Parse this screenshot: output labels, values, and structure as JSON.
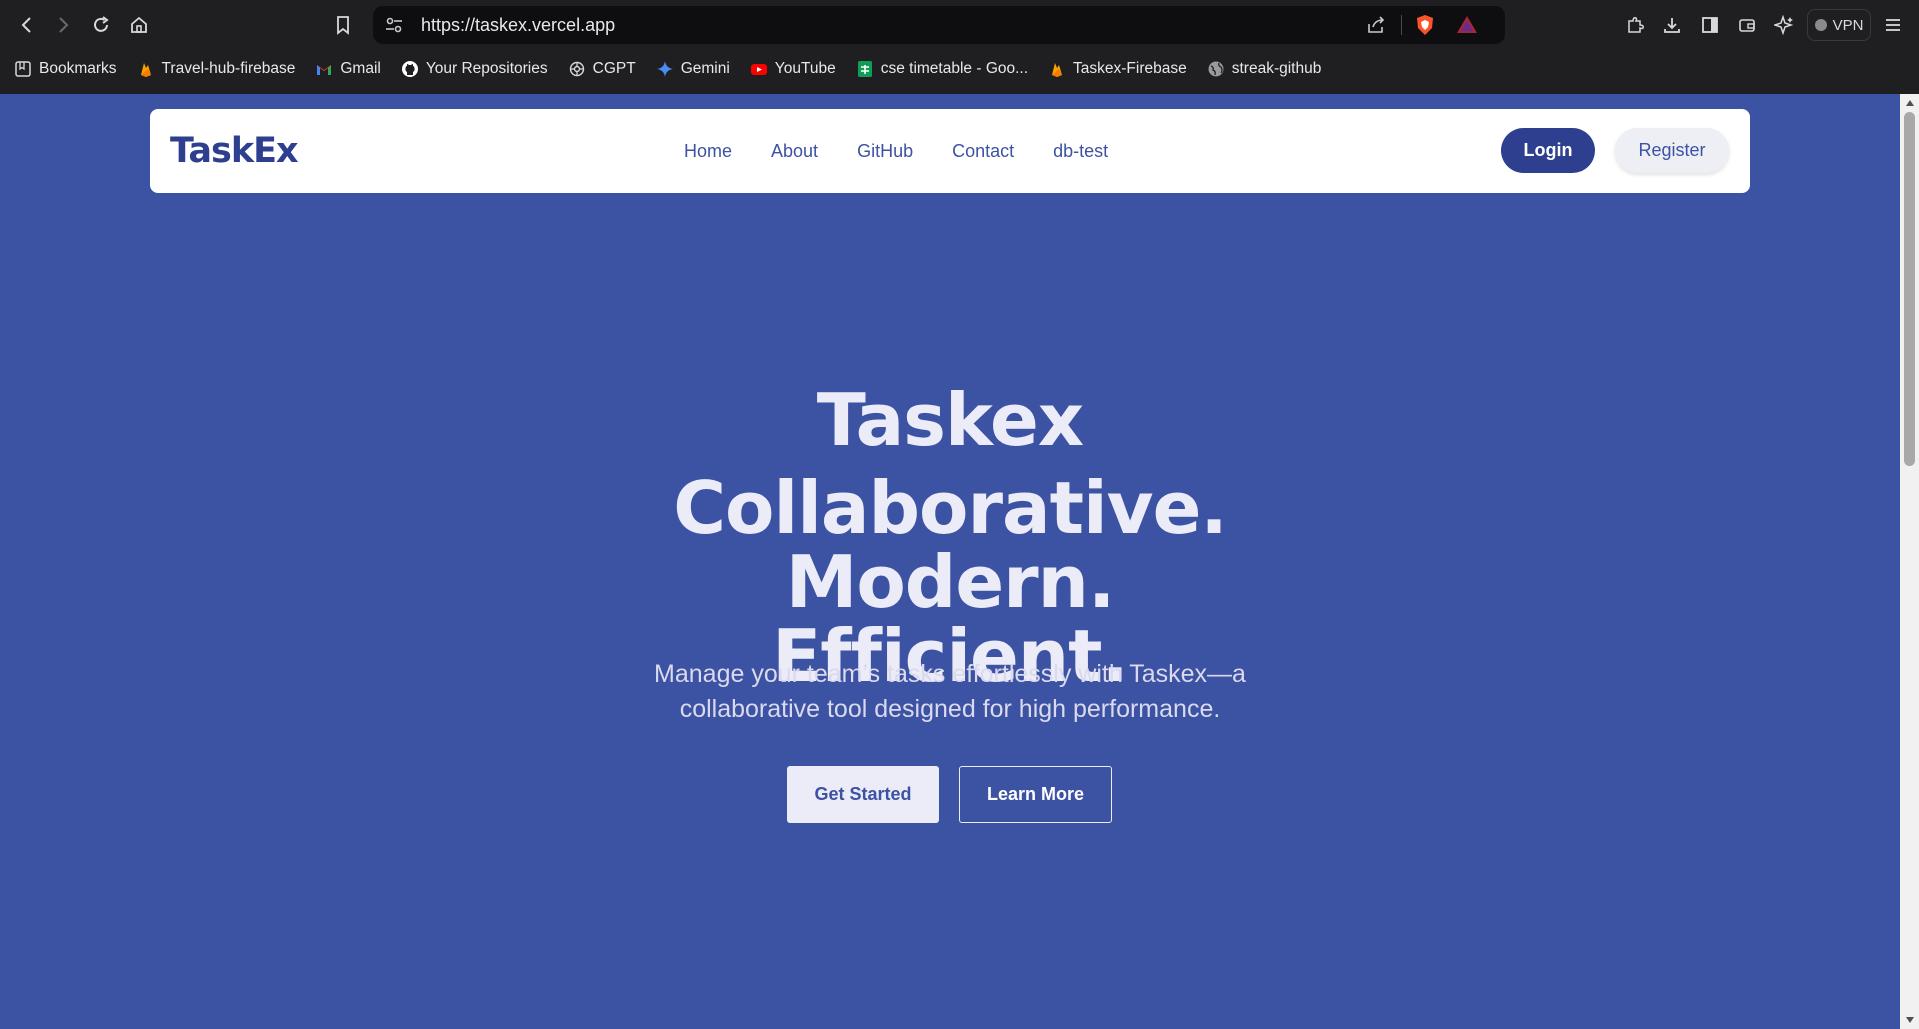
{
  "browser": {
    "url": "https://taskex.vercel.app",
    "vpn_label": "VPN",
    "bookmarks": [
      {
        "label": "Bookmarks",
        "icon": "bookmarks-folder-icon"
      },
      {
        "label": "Travel-hub-firebase",
        "icon": "firebase-icon"
      },
      {
        "label": "Gmail",
        "icon": "gmail-icon"
      },
      {
        "label": "Your Repositories",
        "icon": "github-icon"
      },
      {
        "label": "CGPT",
        "icon": "openai-icon"
      },
      {
        "label": "Gemini",
        "icon": "gemini-icon"
      },
      {
        "label": "YouTube",
        "icon": "youtube-icon"
      },
      {
        "label": "cse timetable - Goo...",
        "icon": "sheets-icon"
      },
      {
        "label": "Taskex-Firebase",
        "icon": "firebase-icon"
      },
      {
        "label": "streak-github",
        "icon": "globe-icon"
      }
    ]
  },
  "navbar": {
    "brand": "TaskEx",
    "links": [
      "Home",
      "About",
      "GitHub",
      "Contact",
      "db-test"
    ],
    "login_label": "Login",
    "register_label": "Register"
  },
  "hero": {
    "title": "Taskex",
    "tagline_line1": "Collaborative. Modern.",
    "tagline_line2": "Efficient.",
    "description_line1": "Manage your team’s tasks effortlessly with Taskex—a",
    "description_line2": "collaborative tool designed for high performance.",
    "primary_cta": "Get Started",
    "secondary_cta": "Learn More"
  },
  "colors": {
    "page_background": "#3c52a3",
    "brand_blue": "#2e3f8f",
    "hero_text": "#ecebf8",
    "chrome_background": "#1f1f22"
  }
}
